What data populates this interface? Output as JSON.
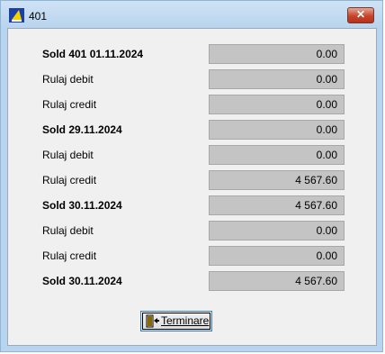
{
  "window": {
    "title": "401",
    "close_glyph": "✕"
  },
  "rows": [
    {
      "label": "Sold 401 01.11.2024",
      "value": "0.00",
      "bold": true
    },
    {
      "label": "Rulaj debit",
      "value": "0.00",
      "bold": false
    },
    {
      "label": "Rulaj credit",
      "value": "0.00",
      "bold": false
    },
    {
      "label": "Sold 29.11.2024",
      "value": "0.00",
      "bold": true
    },
    {
      "label": "Rulaj debit",
      "value": "0.00",
      "bold": false
    },
    {
      "label": "Rulaj credit",
      "value": "4 567.60",
      "bold": false
    },
    {
      "label": "Sold 30.11.2024",
      "value": "4 567.60",
      "bold": true
    },
    {
      "label": "Rulaj debit",
      "value": "0.00",
      "bold": false
    },
    {
      "label": "Rulaj credit",
      "value": "0.00",
      "bold": false
    },
    {
      "label": "Sold 30.11.2024",
      "value": "4 567.60",
      "bold": true
    }
  ],
  "finish_button": {
    "label": "Terminare"
  },
  "colors": {
    "title_bg": "#b9d4ee",
    "client_bg": "#f0f0f0",
    "value_bg": "#c4c4c4",
    "close_red": "#c8432b"
  },
  "icons": {
    "app": "app-icon",
    "close": "close-icon",
    "finish": "exit-door-icon"
  }
}
